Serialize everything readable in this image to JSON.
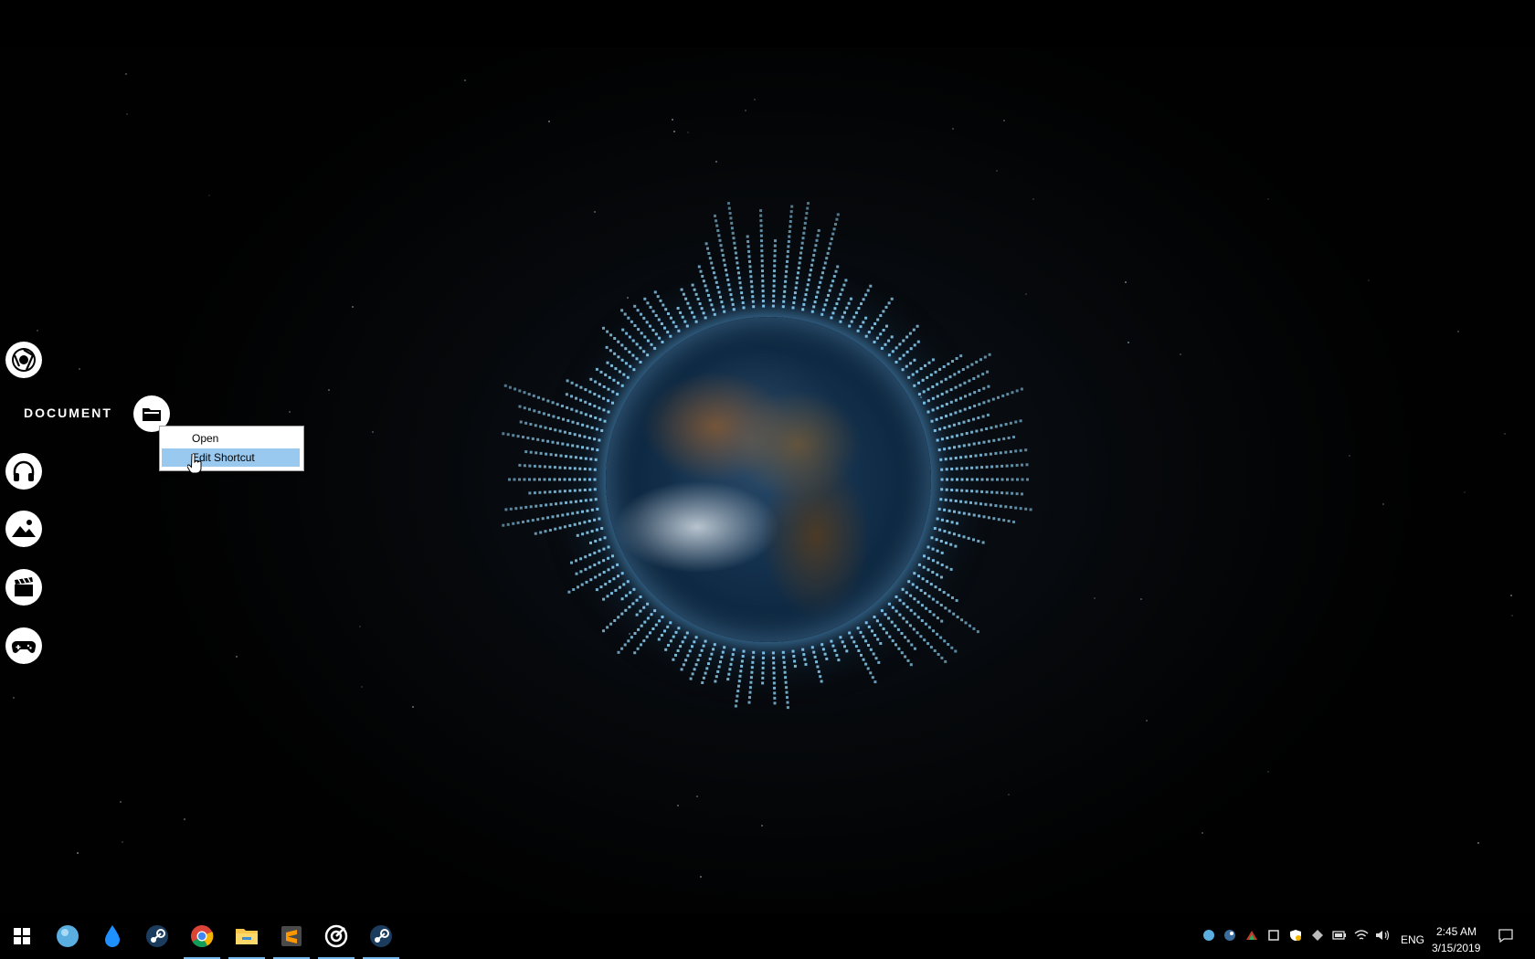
{
  "desktop": {
    "launcher": {
      "items": [
        {
          "name": "chrome-icon"
        },
        {
          "name": "folder-icon",
          "label": "DOCUMENT"
        },
        {
          "name": "headphones-icon"
        },
        {
          "name": "image-icon"
        },
        {
          "name": "clapperboard-icon"
        },
        {
          "name": "gamepad-icon"
        }
      ],
      "document_label": "DOCUMENT"
    },
    "context_menu": {
      "items": [
        "Open",
        "Edit Shortcut"
      ],
      "highlighted": "Edit Shortcut"
    }
  },
  "taskbar": {
    "apps": [
      {
        "name": "start-icon",
        "running": false
      },
      {
        "name": "blue-orb-app-icon",
        "running": false
      },
      {
        "name": "droplet-app-icon",
        "running": false
      },
      {
        "name": "steam-icon",
        "running": false
      },
      {
        "name": "chrome-icon",
        "running": true
      },
      {
        "name": "file-explorer-icon",
        "running": true
      },
      {
        "name": "sublime-text-icon",
        "running": true
      },
      {
        "name": "target-app-icon",
        "running": true
      },
      {
        "name": "steam-icon",
        "running": true
      }
    ],
    "tray": {
      "language": "ENG",
      "time": "2:45 AM",
      "date": "3/15/2019"
    }
  },
  "colors": {
    "accent": "#76b9ed",
    "menu_highlight": "#99c9ef",
    "visualizer": "#8fd3f4"
  }
}
